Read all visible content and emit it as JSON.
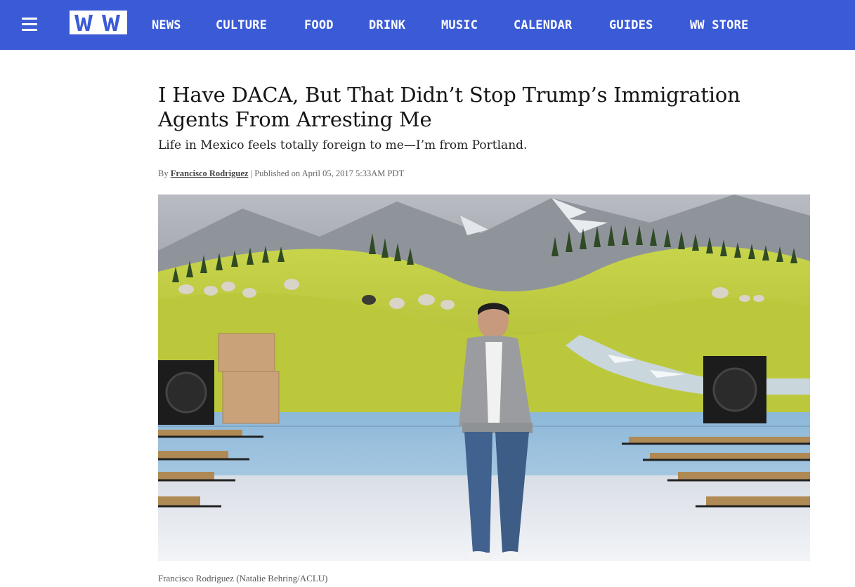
{
  "header": {
    "logo_text": "WW",
    "nav": [
      {
        "label": "NEWS"
      },
      {
        "label": "CULTURE"
      },
      {
        "label": "FOOD"
      },
      {
        "label": "DRINK"
      },
      {
        "label": "MUSIC"
      },
      {
        "label": "CALENDAR"
      },
      {
        "label": "GUIDES"
      },
      {
        "label": "WW STORE"
      }
    ],
    "bar_color": "#3b5bd6"
  },
  "article": {
    "headline": "I Have DACA, But That Didn’t Stop Trump’s Immigration Agents From Arresting Me",
    "dek": "Life in Mexico feels totally foreign to me—I’m from Portland.",
    "byline_prefix": "By",
    "author": "Francisco Rodriguez",
    "published": "| Published on April 05, 2017 5:33AM PDT",
    "photo_caption": "Francisco Rodriguez (Natalie Behring/ACLU)"
  }
}
